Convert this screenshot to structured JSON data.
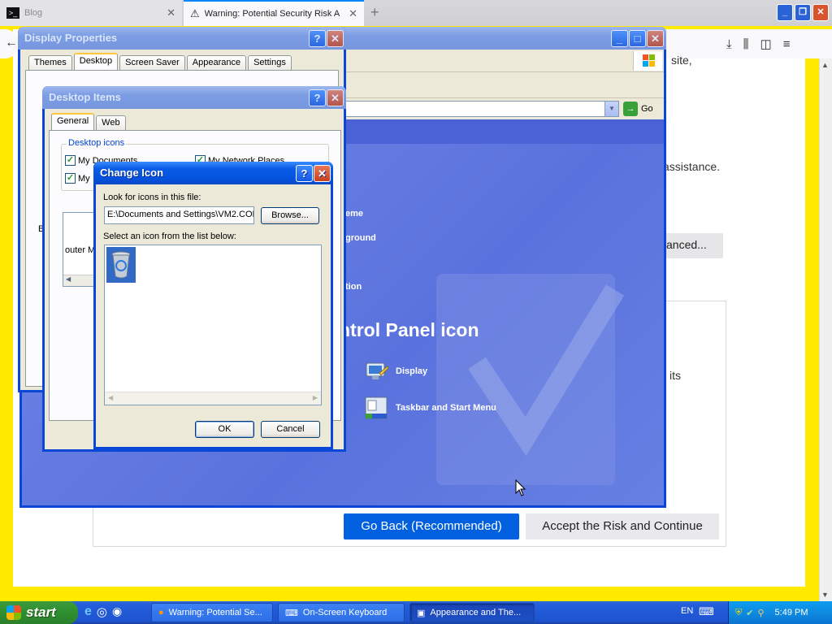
{
  "browser": {
    "tabs": [
      {
        "label": "Blog"
      },
      {
        "label": "Warning: Potential Security Risk Ah"
      }
    ],
    "page": {
      "text_fragments": [
        "site,",
        "assistance.",
        "its"
      ],
      "advanced_label": "anced...",
      "go_back_label": "Go Back (Recommended)",
      "accept_label": "Accept the Risk and Continue"
    }
  },
  "control_panel": {
    "go_label": "Go",
    "fragments": [
      "eme",
      "ground",
      "tion"
    ],
    "heading": "ntrol Panel icon",
    "items": [
      {
        "label": "Display",
        "icon": "display-icon"
      },
      {
        "label": "Taskbar and Start Menu",
        "icon": "taskbar-icon"
      }
    ]
  },
  "display_properties": {
    "title": "Display Properties",
    "tabs": [
      "Themes",
      "Desktop",
      "Screen Saver",
      "Appearance",
      "Settings"
    ],
    "fragment_b": "B"
  },
  "desktop_items": {
    "title": "Desktop Items",
    "tabs": [
      "General",
      "Web"
    ],
    "group_label": "Desktop icons",
    "checks": [
      {
        "label": "My Documents",
        "checked": true
      },
      {
        "label": "My Network Places",
        "checked": true
      },
      {
        "label": "My",
        "checked": true
      }
    ],
    "list_fragments": [
      "outer",
      "M"
    ]
  },
  "change_icon": {
    "title": "Change Icon",
    "look_label": "Look for icons in this file:",
    "path_value": "E:\\Documents and Settings\\VM2.COL",
    "browse_label": "Browse...",
    "select_label": "Select an icon from the list below:",
    "ok_label": "OK",
    "cancel_label": "Cancel"
  },
  "taskbar": {
    "start_label": "start",
    "buttons": [
      {
        "label": "Warning: Potential Se..."
      },
      {
        "label": "On-Screen Keyboard"
      },
      {
        "label": "Appearance and The..."
      }
    ],
    "language": "EN",
    "clock": "5:49 PM"
  },
  "colors": {
    "xp_blue": "#0a5ce4",
    "firefox_blue": "#0060df",
    "page_border": "#ffea00"
  }
}
